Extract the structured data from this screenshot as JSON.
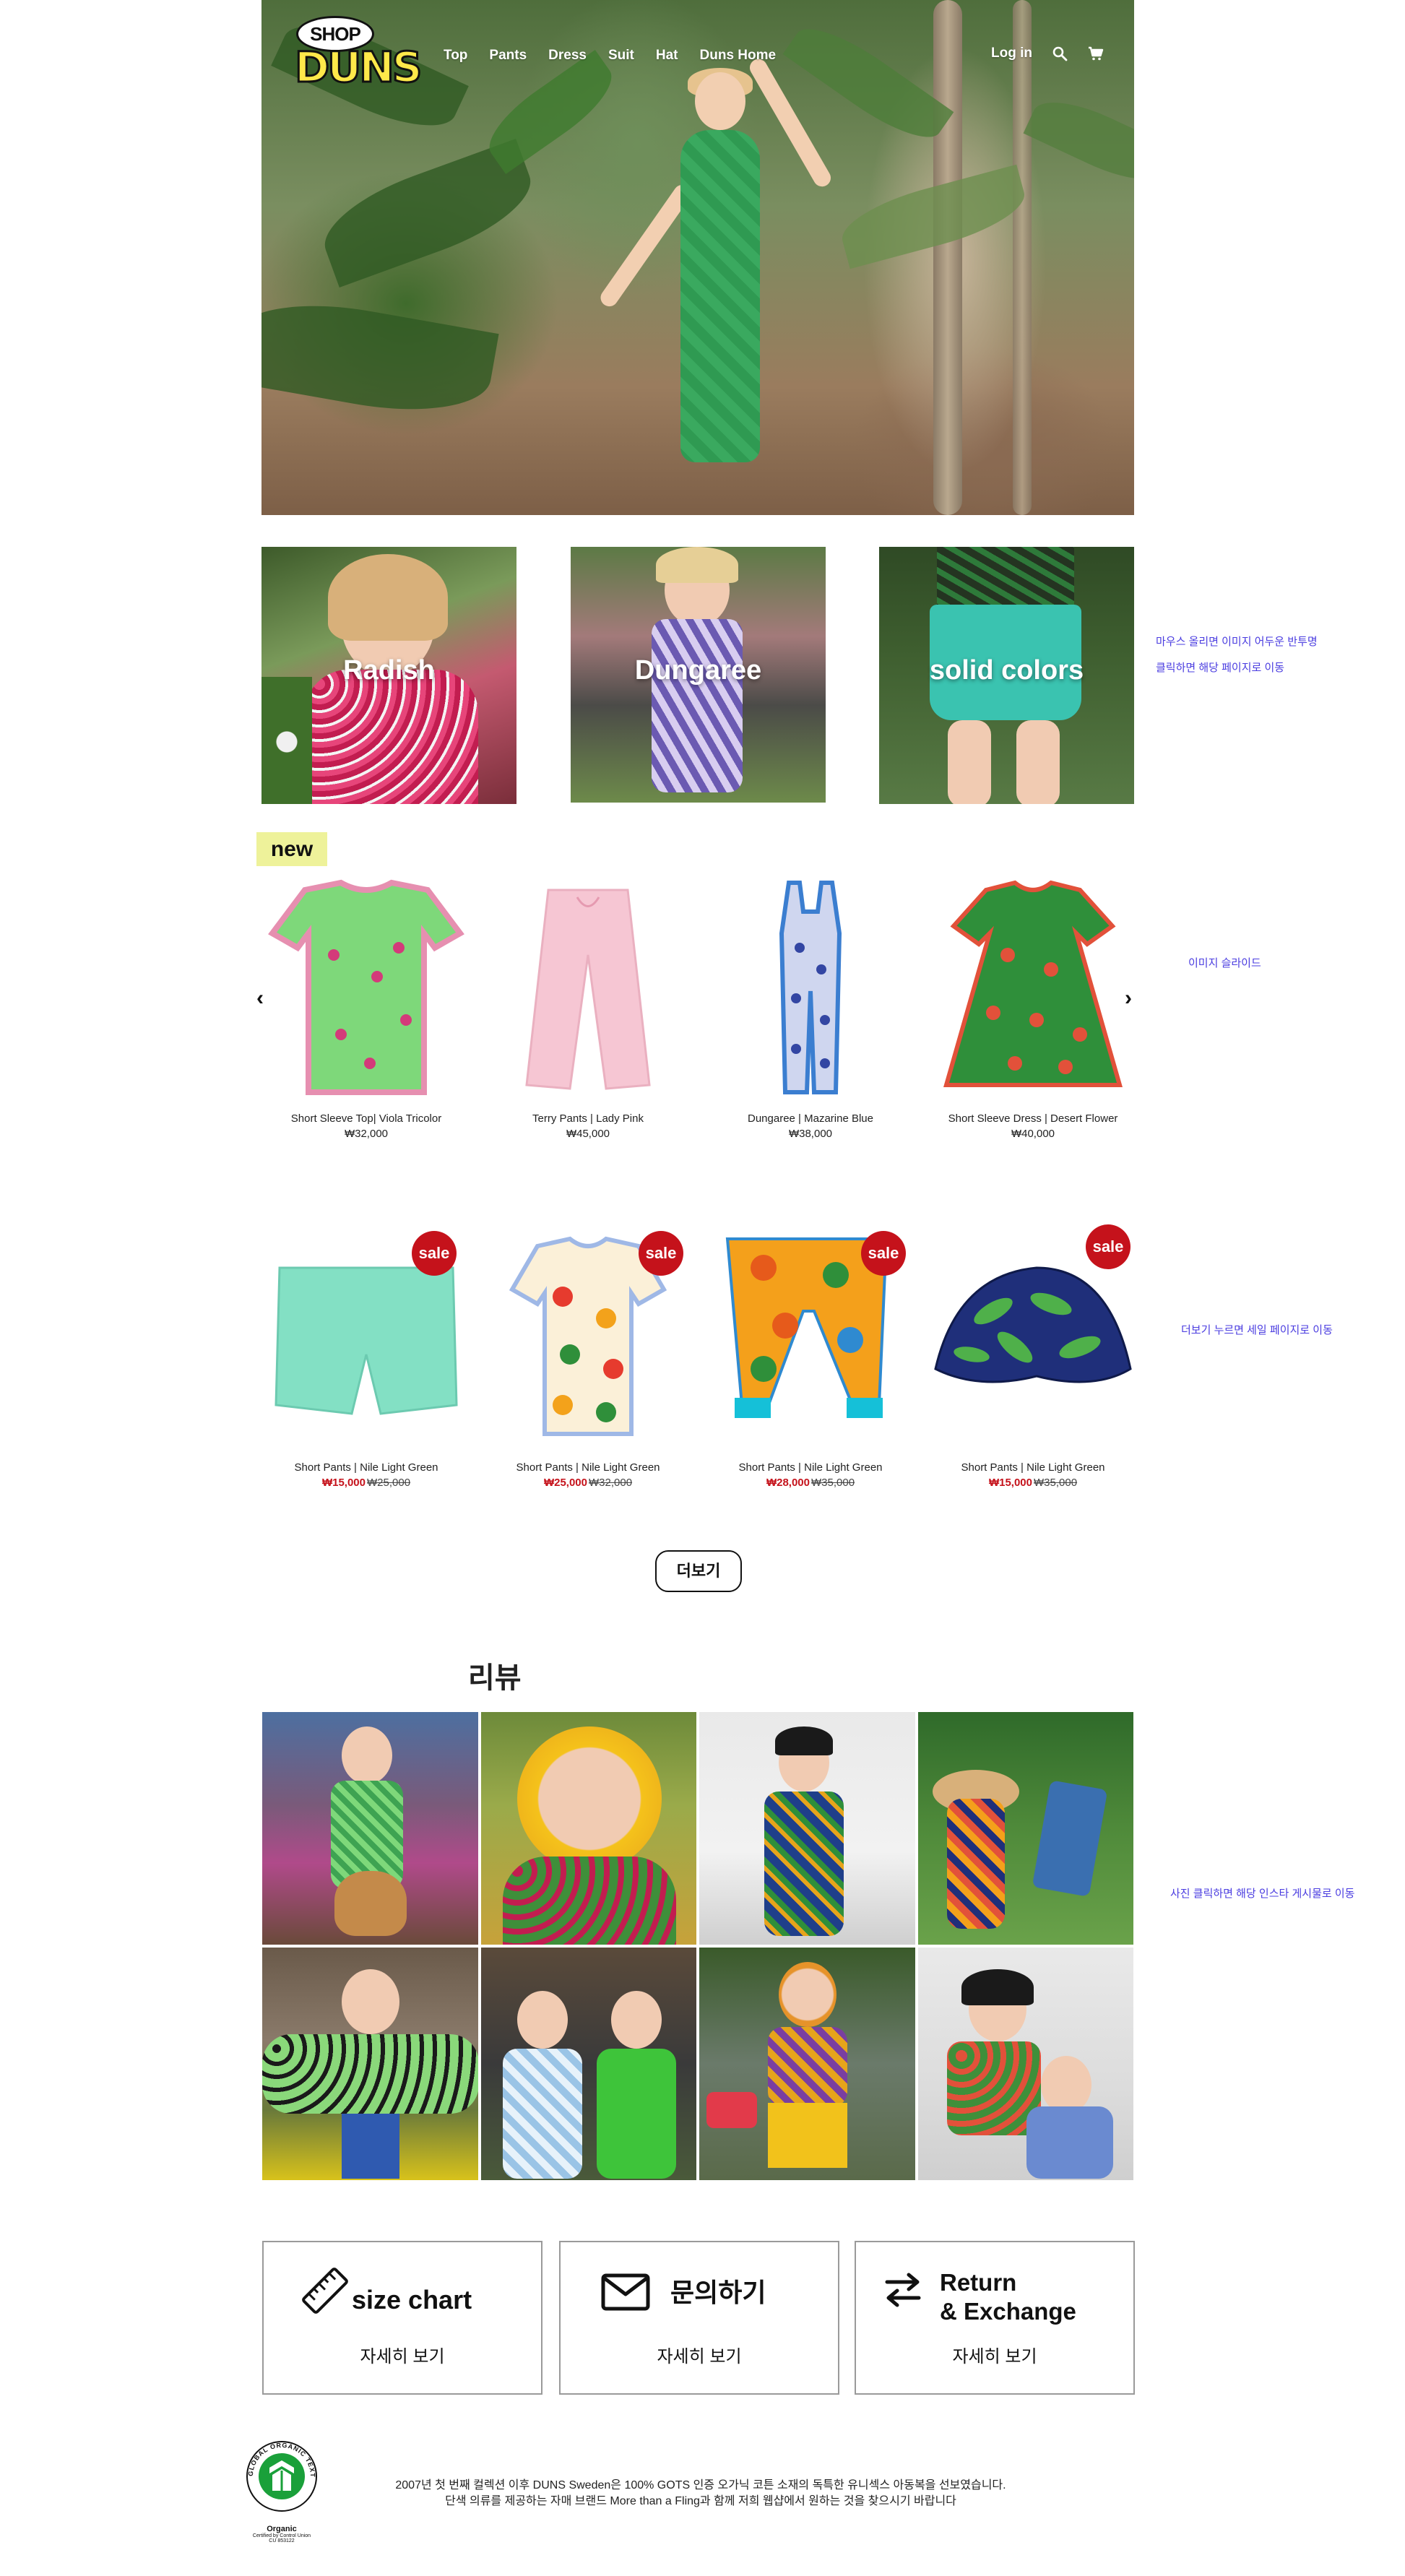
{
  "header": {
    "logo_text_top": "SHOP",
    "logo_text_main": "DUNS",
    "nav": [
      "Top",
      "Pants",
      "Dress",
      "Suit",
      "Hat",
      "Duns Home"
    ],
    "login_label": "Log in",
    "search_icon": "search-icon",
    "cart_icon": "cart-icon"
  },
  "categories": [
    {
      "label": "Radish"
    },
    {
      "label": "Dungaree"
    },
    {
      "label": "solid colors"
    }
  ],
  "notes": {
    "category_hover": "마우스 올리면 이미지  어두운 반투명",
    "category_click": "클릭하면 해당 페이지로 이동",
    "slider": "이미지 슬라이드",
    "sale_more": "더보기 누르면 세일 페이지로 이동",
    "review_click": "사진 클릭하면 해당 인스타 게시물로 이동"
  },
  "new_section": {
    "badge": "new",
    "prev_icon": "chevron-left-icon",
    "next_icon": "chevron-right-icon",
    "products": [
      {
        "name": "Short Sleeve Top| Viola Tricolor",
        "price": "₩32,000"
      },
      {
        "name": "Terry Pants | Lady Pink",
        "price": "₩45,000"
      },
      {
        "name": "Dungaree | Mazarine Blue",
        "price": "₩38,000"
      },
      {
        "name": "Short Sleeve  Dress | Desert Flower",
        "price": "₩40,000"
      }
    ]
  },
  "sale_section": {
    "badge": "sale",
    "products": [
      {
        "name": "Short Pants | Nile Light Green",
        "sale_price": "₩15,000",
        "orig_price": "₩25,000"
      },
      {
        "name": "Short Pants | Nile Light Green",
        "sale_price": "₩25,000",
        "orig_price": "₩32,000"
      },
      {
        "name": "Short Pants | Nile Light Green",
        "sale_price": "₩28,000",
        "orig_price": "₩35,000"
      },
      {
        "name": "Short Pants | Nile Light Green",
        "sale_price": "₩15,000",
        "orig_price": "₩35,000"
      }
    ],
    "more_label": "더보기"
  },
  "reviews": {
    "title": "리뷰",
    "photo_count": 8
  },
  "info_boxes": [
    {
      "title": "size chart",
      "sub": "자세히 보기",
      "icon": "ruler-icon"
    },
    {
      "title": "문의하기",
      "sub": "자세히 보기",
      "icon": "mail-icon"
    },
    {
      "title_line1": "Return",
      "title_line2": "& Exchange",
      "sub": "자세히 보기",
      "icon": "exchange-arrows-icon"
    }
  ],
  "footer": {
    "line1": "2007년 첫 번째 컬렉션 이후 DUNS Sweden은 100% GOTS 인증 오가닉 코튼 소재의 독특한 유니섹스 아동복을 선보였습니다.",
    "line2": "단색 의류를 제공하는 자매 브랜드 More than a Fling과 함께 저희 웹샵에서 원하는 것을 찾으시기 바랍니다",
    "gots_logo_text": "GLOBAL ORGANIC TEXTILE STANDARD",
    "gots_label": "Organic",
    "gots_certified": "Certified by Control Union",
    "gots_cu": "CU 853122"
  },
  "colors": {
    "accent_new": "#eef29a",
    "sale_red": "#c5121b",
    "note_blue": "#4a3ce0",
    "logo_yellow": "#ffe94a"
  }
}
